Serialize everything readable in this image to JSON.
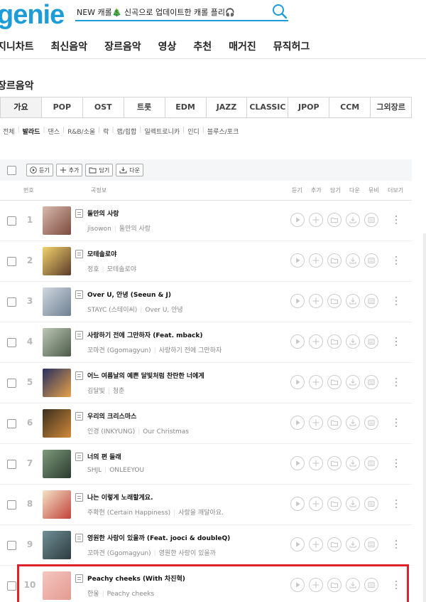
{
  "header": {
    "logo": "genie",
    "search_value": "NEW 캐롤🎄 신곡으로 업데이트한 캐롤 플리🎧",
    "search_icon": "search-icon"
  },
  "nav": [
    "지니차트",
    "최신음악",
    "장르음악",
    "영상",
    "추천",
    "매거진",
    "뮤직허그"
  ],
  "section_title": "장르음악",
  "genre_tabs": [
    "가요",
    "POP",
    "OST",
    "트롯",
    "EDM",
    "JAZZ",
    "CLASSIC",
    "JPOP",
    "CCM",
    "그외장르"
  ],
  "active_genre": "가요",
  "subgenres": [
    "전체",
    "발라드",
    "댄스",
    "R&B/소울",
    "락",
    "랩/힙합",
    "일렉트로니카",
    "인디",
    "블루스/포크"
  ],
  "active_subgenre": "발라드",
  "toolbar": {
    "play": "듣기",
    "add": "추가",
    "save": "담기",
    "download": "다운"
  },
  "columns": {
    "num": "번호",
    "info": "곡정보",
    "play": "듣기",
    "add": "추가",
    "save": "담기",
    "download": "다운",
    "mv": "뮤비",
    "more": "더보기"
  },
  "tracks": [
    {
      "rank": "1",
      "title": "둘만의 사랑",
      "artist": "jisowon",
      "album": "둘만의 사랑",
      "cover": [
        "#d9b9ad",
        "#7a4b3e"
      ]
    },
    {
      "rank": "2",
      "title": "모테솔로야",
      "artist": "정호",
      "album": "모테솔로야",
      "cover": [
        "#f2d36b",
        "#5a3a2a"
      ]
    },
    {
      "rank": "3",
      "title": "Over U, 안녕 (Seeun & J)",
      "artist": "STAYC (스테이씨)",
      "album": "Over U, 안녕",
      "cover": [
        "#cfd8df",
        "#6e7f90"
      ]
    },
    {
      "rank": "4",
      "title": "사랑하기 전에 그만하자 (Feat. mback)",
      "artist": "꼬마견 (Ggomagyun)",
      "album": "사랑하기 전에 그만하자",
      "cover": [
        "#bcc7b4",
        "#4b5a48"
      ]
    },
    {
      "rank": "5",
      "title": "어느 여름날의 예쁜 달빛처럼 찬란한 너에게",
      "artist": "김달빛",
      "album": "청춘",
      "cover": [
        "#26305e",
        "#e6a24a"
      ]
    },
    {
      "rank": "6",
      "title": "우리의 크리스마스",
      "artist": "인경 (INKYUNG)",
      "album": "Our Christmas",
      "cover": [
        "#3a2e1e",
        "#d18a3a"
      ]
    },
    {
      "rank": "7",
      "title": "너의 편 들래",
      "artist": "SHJL",
      "album": "ONLEEYOU",
      "cover": [
        "#7d9a7a",
        "#2b3a2f"
      ]
    },
    {
      "rank": "8",
      "title": "나는 이렇게 노래할게요.",
      "artist": "주확현 (Certain Happiness)",
      "album": "사랑을 깨달아요.",
      "cover": [
        "#f3e3c7",
        "#c2423b"
      ]
    },
    {
      "rank": "9",
      "title": "영원한 사랑이 있을까 (Feat. jooci & doubleQ)",
      "artist": "꼬마견 (Ggomagyun)",
      "album": "영원한 사랑이 있을까",
      "cover": [
        "#6f8f96",
        "#2d3c3f"
      ]
    },
    {
      "rank": "10",
      "title": "Peachy cheeks (With 차진혁)",
      "artist": "한울",
      "album": "Peachy cheeks",
      "cover": [
        "#f4c6bf",
        "#e39a92"
      ]
    }
  ],
  "colors": {
    "brand": "#1e9cd7",
    "highlight": "#e0202a"
  }
}
